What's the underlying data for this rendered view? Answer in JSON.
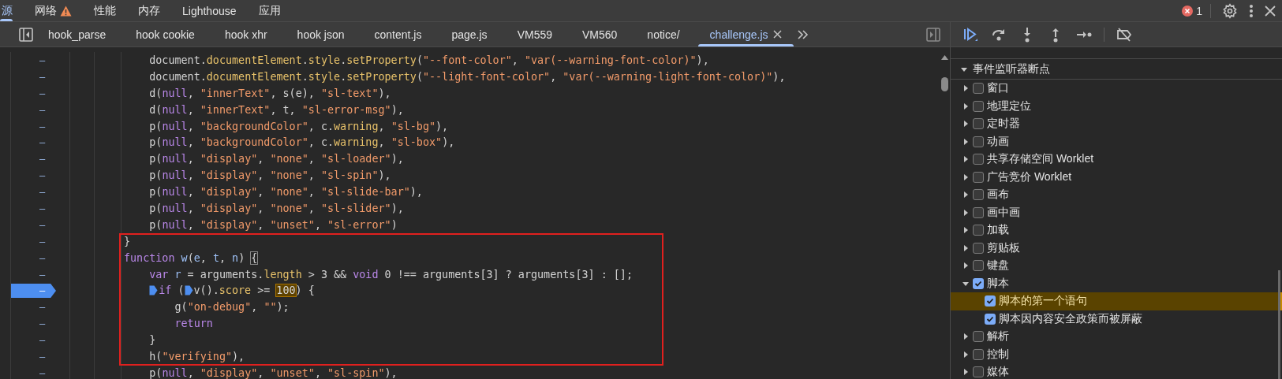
{
  "panel_tabs": [
    {
      "label": "源",
      "selected": true
    },
    {
      "label": "网络",
      "selected": false,
      "warning": true
    },
    {
      "label": "性能",
      "selected": false
    },
    {
      "label": "内存",
      "selected": false
    },
    {
      "label": "Lighthouse",
      "selected": false
    },
    {
      "label": "应用",
      "selected": false
    }
  ],
  "error_count": "1",
  "file_tabs": [
    {
      "label": "hook_parse",
      "selected": false
    },
    {
      "label": "hook cookie",
      "selected": false
    },
    {
      "label": "hook xhr",
      "selected": false
    },
    {
      "label": "hook json",
      "selected": false
    },
    {
      "label": "content.js",
      "selected": false
    },
    {
      "label": "page.js",
      "selected": false
    },
    {
      "label": "VM559",
      "selected": false
    },
    {
      "label": "VM560",
      "selected": false
    },
    {
      "label": "notice/",
      "selected": false
    },
    {
      "label": "challenge.js",
      "selected": true
    }
  ],
  "debugger_toolbar": [
    {
      "kind": "resume",
      "active": true
    },
    {
      "kind": "step_over",
      "active": false
    },
    {
      "kind": "step_into",
      "active": false
    },
    {
      "kind": "step_out",
      "active": false
    },
    {
      "kind": "step",
      "active": false
    },
    {
      "kind": "separator"
    },
    {
      "kind": "deactivate",
      "active": false
    }
  ],
  "code_lines": [
    {
      "mark": "–",
      "breakpoint": false,
      "tokens": [
        {
          "plain": "    document."
        },
        {
          "prop": "documentElement"
        },
        {
          "plain": "."
        },
        {
          "prop": "style"
        },
        {
          "plain": "."
        },
        {
          "prop": "setProperty"
        },
        {
          "plain": "("
        },
        {
          "string": "\"--font-color\""
        },
        {
          "plain": ", "
        },
        {
          "string": "\"var(--warning-font-color)\""
        },
        {
          "plain": "),"
        }
      ]
    },
    {
      "mark": "–",
      "breakpoint": false,
      "tokens": [
        {
          "plain": "    document."
        },
        {
          "prop": "documentElement"
        },
        {
          "plain": "."
        },
        {
          "prop": "style"
        },
        {
          "plain": "."
        },
        {
          "prop": "setProperty"
        },
        {
          "plain": "("
        },
        {
          "string": "\"--light-font-color\""
        },
        {
          "plain": ", "
        },
        {
          "string": "\"var(--warning-light-font-color)\""
        },
        {
          "plain": "),"
        }
      ]
    },
    {
      "mark": "–",
      "breakpoint": false,
      "tokens": [
        {
          "plain": "    d("
        },
        {
          "keyword": "null"
        },
        {
          "plain": ", "
        },
        {
          "string": "\"innerText\""
        },
        {
          "plain": ", s(e), "
        },
        {
          "string": "\"sl-text\""
        },
        {
          "plain": "),"
        }
      ]
    },
    {
      "mark": "–",
      "breakpoint": false,
      "tokens": [
        {
          "plain": "    d("
        },
        {
          "keyword": "null"
        },
        {
          "plain": ", "
        },
        {
          "string": "\"innerText\""
        },
        {
          "plain": ", t, "
        },
        {
          "string": "\"sl-error-msg\""
        },
        {
          "plain": "),"
        }
      ]
    },
    {
      "mark": "–",
      "breakpoint": false,
      "tokens": [
        {
          "plain": "    p("
        },
        {
          "keyword": "null"
        },
        {
          "plain": ", "
        },
        {
          "string": "\"backgroundColor\""
        },
        {
          "plain": ", c."
        },
        {
          "prop": "warning"
        },
        {
          "plain": ", "
        },
        {
          "string": "\"sl-bg\""
        },
        {
          "plain": "),"
        }
      ]
    },
    {
      "mark": "–",
      "breakpoint": false,
      "tokens": [
        {
          "plain": "    p("
        },
        {
          "keyword": "null"
        },
        {
          "plain": ", "
        },
        {
          "string": "\"backgroundColor\""
        },
        {
          "plain": ", c."
        },
        {
          "prop": "warning"
        },
        {
          "plain": ", "
        },
        {
          "string": "\"sl-box\""
        },
        {
          "plain": "),"
        }
      ]
    },
    {
      "mark": "–",
      "breakpoint": false,
      "tokens": [
        {
          "plain": "    p("
        },
        {
          "keyword": "null"
        },
        {
          "plain": ", "
        },
        {
          "string": "\"display\""
        },
        {
          "plain": ", "
        },
        {
          "string": "\"none\""
        },
        {
          "plain": ", "
        },
        {
          "string": "\"sl-loader\""
        },
        {
          "plain": "),"
        }
      ]
    },
    {
      "mark": "–",
      "breakpoint": false,
      "tokens": [
        {
          "plain": "    p("
        },
        {
          "keyword": "null"
        },
        {
          "plain": ", "
        },
        {
          "string": "\"display\""
        },
        {
          "plain": ", "
        },
        {
          "string": "\"none\""
        },
        {
          "plain": ", "
        },
        {
          "string": "\"sl-spin\""
        },
        {
          "plain": "),"
        }
      ]
    },
    {
      "mark": "–",
      "breakpoint": false,
      "tokens": [
        {
          "plain": "    p("
        },
        {
          "keyword": "null"
        },
        {
          "plain": ", "
        },
        {
          "string": "\"display\""
        },
        {
          "plain": ", "
        },
        {
          "string": "\"none\""
        },
        {
          "plain": ", "
        },
        {
          "string": "\"sl-slide-bar\""
        },
        {
          "plain": "),"
        }
      ]
    },
    {
      "mark": "–",
      "breakpoint": false,
      "tokens": [
        {
          "plain": "    p("
        },
        {
          "keyword": "null"
        },
        {
          "plain": ", "
        },
        {
          "string": "\"display\""
        },
        {
          "plain": ", "
        },
        {
          "string": "\"none\""
        },
        {
          "plain": ", "
        },
        {
          "string": "\"sl-slider\""
        },
        {
          "plain": "),"
        }
      ]
    },
    {
      "mark": "–",
      "breakpoint": false,
      "tokens": [
        {
          "plain": "    p("
        },
        {
          "keyword": "null"
        },
        {
          "plain": ", "
        },
        {
          "string": "\"display\""
        },
        {
          "plain": ", "
        },
        {
          "string": "\"unset\""
        },
        {
          "plain": ", "
        },
        {
          "string": "\"sl-error\""
        },
        {
          "plain": ")"
        }
      ]
    },
    {
      "mark": "–",
      "breakpoint": false,
      "tokens": [
        {
          "plain": "}"
        }
      ]
    },
    {
      "mark": "–",
      "breakpoint": false,
      "tokens": [
        {
          "keyword": "function "
        },
        {
          "ident": "w"
        },
        {
          "plain": "("
        },
        {
          "ident": "e"
        },
        {
          "plain": ", "
        },
        {
          "ident": "t"
        },
        {
          "plain": ", "
        },
        {
          "ident": "n"
        },
        {
          "plain": ") "
        },
        {
          "bracket": "{"
        }
      ]
    },
    {
      "mark": "–",
      "breakpoint": false,
      "tokens": [
        {
          "keyword": "    var "
        },
        {
          "ident": "r"
        },
        {
          "plain": " = arguments."
        },
        {
          "prop": "length"
        },
        {
          "plain": " > 3 && "
        },
        {
          "keyword": "void"
        },
        {
          "plain": " 0 !== arguments[3] ? arguments[3] : [];"
        }
      ]
    },
    {
      "mark": "–",
      "breakpoint": true,
      "tokens": [
        {
          "marker": true
        },
        {
          "keyword": "if"
        },
        {
          "plain": " ("
        },
        {
          "marker": true
        },
        {
          "plain": "v()."
        },
        {
          "prop": "score"
        },
        {
          "plain": " >= "
        },
        {
          "match": "100"
        },
        {
          "plain": ") {"
        }
      ]
    },
    {
      "mark": "–",
      "breakpoint": false,
      "tokens": [
        {
          "plain": "        g("
        },
        {
          "string": "\"on-debug\""
        },
        {
          "plain": ", "
        },
        {
          "string": "\"\""
        },
        {
          "plain": ");"
        }
      ]
    },
    {
      "mark": "–",
      "breakpoint": false,
      "tokens": [
        {
          "keyword": "        return"
        }
      ]
    },
    {
      "mark": "–",
      "breakpoint": false,
      "tokens": [
        {
          "plain": "    }"
        }
      ]
    },
    {
      "mark": "–",
      "breakpoint": false,
      "tokens": [
        {
          "plain": "    h("
        },
        {
          "string": "\"verifying\""
        },
        {
          "plain": "),"
        }
      ]
    },
    {
      "mark": "–",
      "breakpoint": false,
      "tokens": [
        {
          "plain": "    p("
        },
        {
          "keyword": "null"
        },
        {
          "plain": ", "
        },
        {
          "string": "\"display\""
        },
        {
          "plain": ", "
        },
        {
          "string": "\"unset\""
        },
        {
          "plain": ", "
        },
        {
          "string": "\"sl-spin\""
        },
        {
          "plain": "),"
        }
      ]
    }
  ],
  "annotation": {
    "kind": "rectangle"
  },
  "breakpoints_panel": {
    "section": {
      "label": "事件监听器断点",
      "expanded": true
    },
    "items": [
      {
        "label": "窗口",
        "checked": false,
        "expanded": false
      },
      {
        "label": "地理定位",
        "checked": false,
        "expanded": false
      },
      {
        "label": "定时器",
        "checked": false,
        "expanded": false
      },
      {
        "label": "动画",
        "checked": false,
        "expanded": false
      },
      {
        "label": "共享存储空间 Worklet",
        "checked": false,
        "expanded": false
      },
      {
        "label": "广告竞价 Worklet",
        "checked": false,
        "expanded": false
      },
      {
        "label": "画布",
        "checked": false,
        "expanded": false
      },
      {
        "label": "画中画",
        "checked": false,
        "expanded": false
      },
      {
        "label": "加载",
        "checked": false,
        "expanded": false
      },
      {
        "label": "剪贴板",
        "checked": false,
        "expanded": false
      },
      {
        "label": "键盘",
        "checked": false,
        "expanded": false
      },
      {
        "label": "脚本",
        "checked": true,
        "expanded": true,
        "children": [
          {
            "label": "脚本的第一个语句",
            "checked": true,
            "highlighted": true
          },
          {
            "label": "脚本因内容安全政策而被屏蔽",
            "checked": true,
            "highlighted": false
          }
        ]
      },
      {
        "label": "解析",
        "checked": false,
        "expanded": false
      },
      {
        "label": "控制",
        "checked": false,
        "expanded": false
      },
      {
        "label": "媒体",
        "checked": false,
        "expanded": false
      }
    ]
  }
}
